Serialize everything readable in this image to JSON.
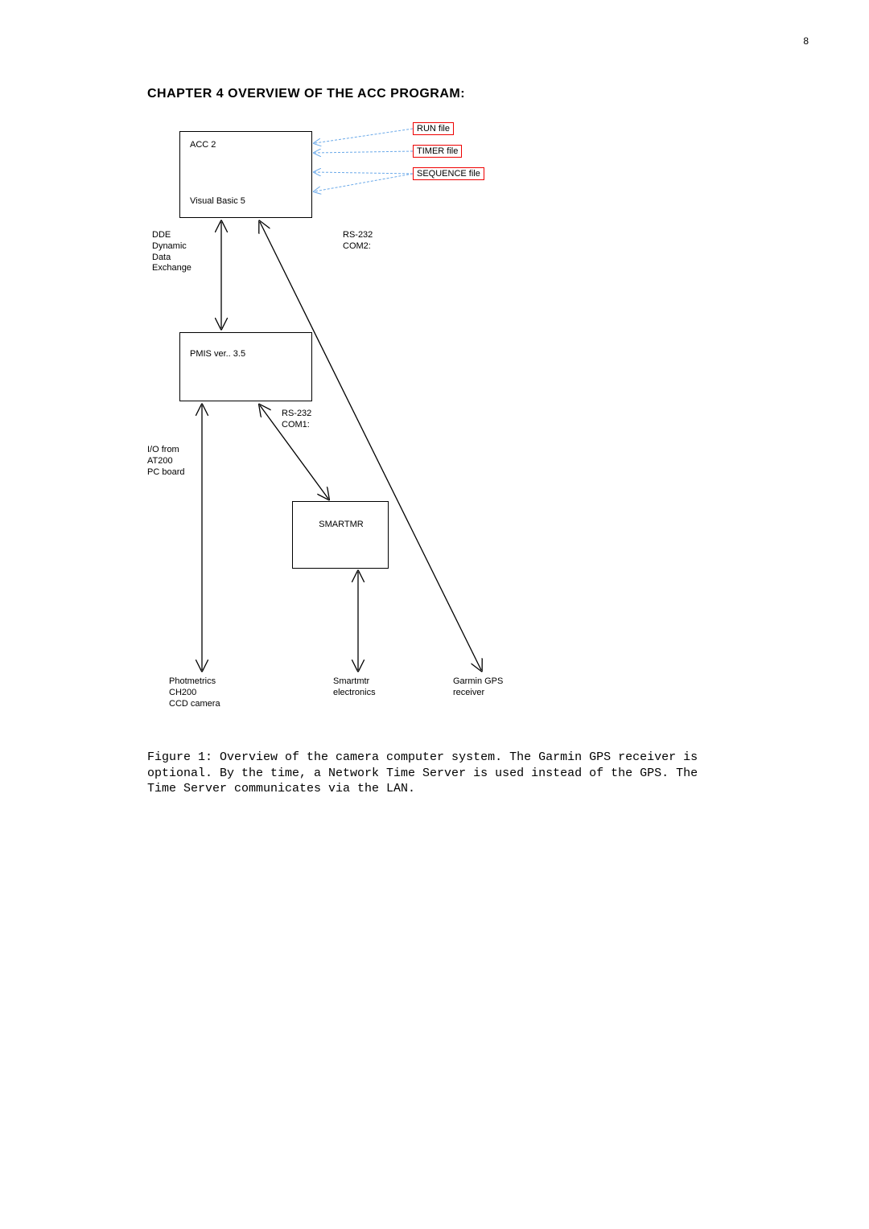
{
  "pageNumber": "8",
  "heading": "CHAPTER 4 OVERVIEW OF THE ACC PROGRAM:",
  "boxes": {
    "acc": "ACC 2",
    "vb5": "Visual Basic 5",
    "pmis": "PMIS ver.. 3.5",
    "smartmr": "SMARTMR"
  },
  "files": {
    "run": "RUN file",
    "timer": "TIMER file",
    "sequence": "SEQUENCE file"
  },
  "labels": {
    "dde": "DDE\nDynamic\nData\nExchange",
    "rs232a": "RS-232\nCOM2:",
    "rs232b": "RS-232\nCOM1:",
    "io": "I/O from\nAT200\nPC board",
    "photmetrics": "Photmetrics\nCH200\nCCD camera",
    "smartmtr": "Smartmtr\nelectronics",
    "garmin": "Garmin GPS\nreceiver"
  },
  "caption": "Figure 1: Overview of the camera computer system. The Garmin GPS receiver is optional. By the time, a Network Time Server is used instead of the GPS. The Time Server communicates via the LAN."
}
